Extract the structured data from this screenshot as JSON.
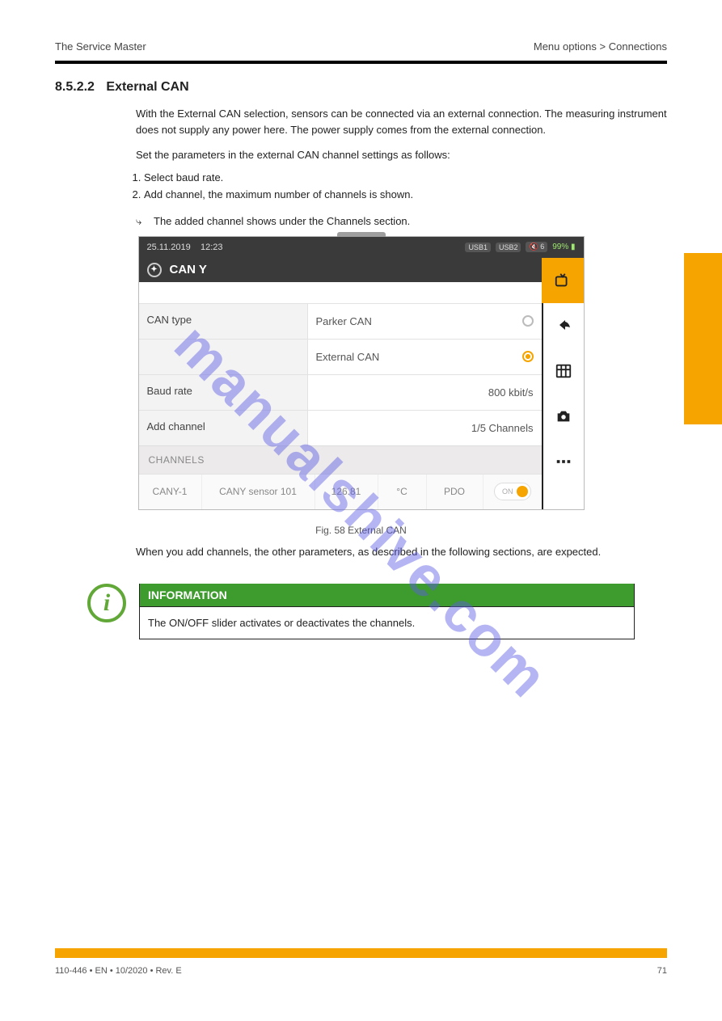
{
  "header": {
    "doc_title": "The Service Master",
    "breadcrumb": "Menu options > Connections"
  },
  "section": {
    "num": "8.5.2.2",
    "title": "External CAN"
  },
  "intro1": "With the External CAN selection, sensors can be connected via an external connection. The measuring instrument does not supply any power here. The power supply comes from the external connection.",
  "intro2": "Set the parameters in the external CAN channel settings as follows:",
  "steps": [
    "Select baud rate.",
    "Add channel, the maximum number of channels is shown."
  ],
  "result": "The added channel shows under the Channels section.",
  "device": {
    "date": "25.11.2019",
    "time": "12:23",
    "usb1": "USB1",
    "usb2": "USB2",
    "vol": "6",
    "batt": "99%",
    "title": "CAN Y",
    "rows": {
      "can_type_label": "CAN type",
      "can_type_val": "Parker CAN",
      "ext_can_val": "External CAN",
      "baud_label": "Baud rate",
      "baud_val": "800 kbit/s",
      "add_label": "Add channel",
      "add_val": "1/5 Channels"
    },
    "channels_header": "CHANNELS",
    "channel": {
      "id": "CANY-1",
      "name": "CANY sensor 101",
      "value": "126.81",
      "unit": "°C",
      "mode": "PDO",
      "toggle": "ON"
    }
  },
  "figure_caption": "Fig. 58  External CAN",
  "post_text": "When you add channels, the other parameters, as described in the following sections, are expected.",
  "info": {
    "head": "INFORMATION",
    "body": "The ON/OFF slider activates or deactivates the channels."
  },
  "watermark": "manualshive.com",
  "footer": {
    "left": "110-446 • EN • 10/2020 • Rev. E",
    "right": "71"
  }
}
